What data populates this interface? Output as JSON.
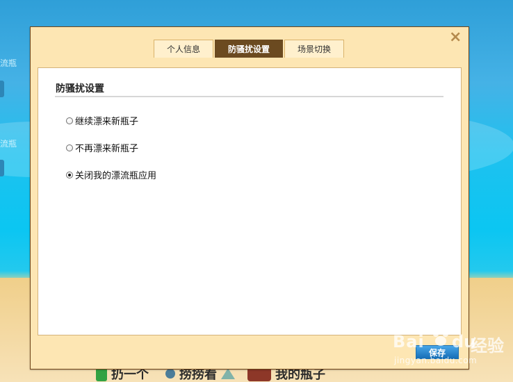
{
  "background": {
    "left_labels": [
      "流瓶",
      "流瓶"
    ],
    "bottom_nav": [
      {
        "label": "扔一个",
        "icon": "bottle-icon"
      },
      {
        "label": "捞捞看",
        "icon": "pin-icon"
      },
      {
        "label": "我的瓶子",
        "icon": "chest-icon"
      }
    ]
  },
  "dialog": {
    "close_label": "×",
    "tabs": [
      "个人信息",
      "防骚扰设置",
      "场景切换"
    ],
    "section_title": "防骚扰设置",
    "options": [
      "继续漂来新瓶子",
      "不再漂来新瓶子",
      "关闭我的漂流瓶应用"
    ],
    "save_label": "保存"
  },
  "watermark": {
    "brand_left": "Bai",
    "brand_middle": "du",
    "brand_right": "经验",
    "site": "jingyan.baidu.com"
  }
}
